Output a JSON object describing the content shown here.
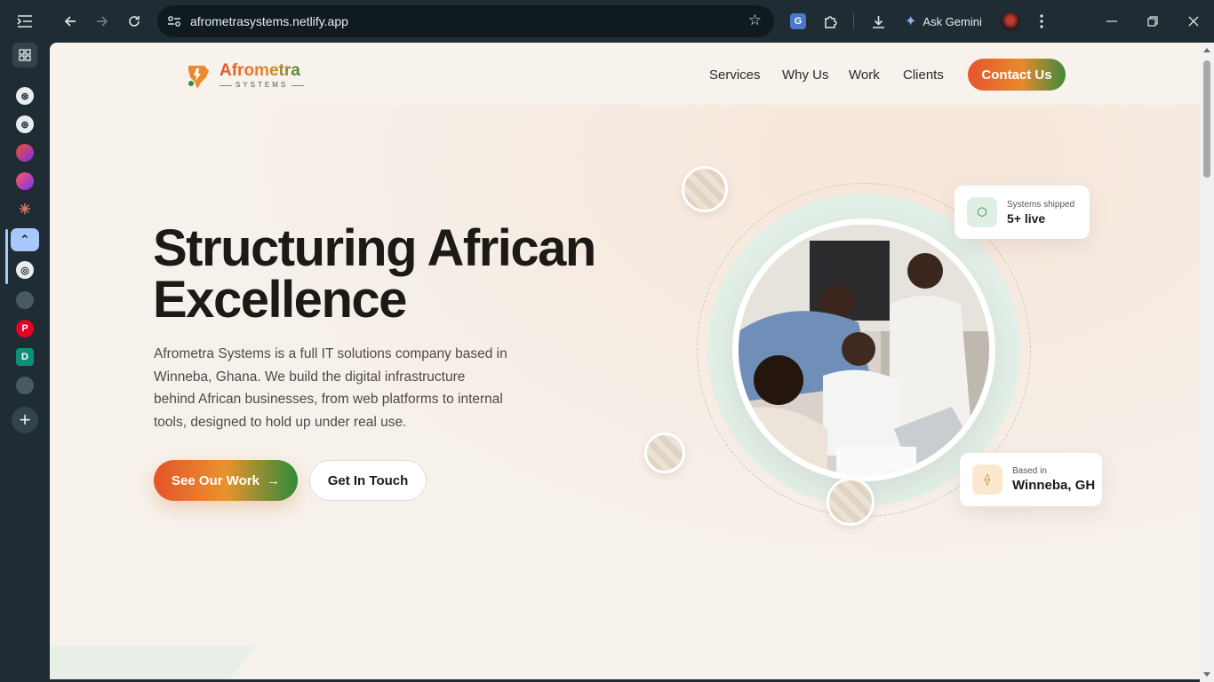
{
  "browser": {
    "url": "afrometrasystems.netlify.app",
    "gemini_label": "Ask Gemini"
  },
  "icons": {
    "sidebar_toggle": "sidebar-toggle-icon",
    "back": "back-arrow-icon",
    "forward": "forward-arrow-icon",
    "reload": "reload-icon",
    "site_info": "site-settings-icon",
    "bookmark": "star-icon",
    "translate": "translate-icon",
    "extensions": "puzzle-icon",
    "download": "download-icon",
    "gemini": "gemini-spark-icon",
    "menu": "kebab-menu-icon"
  },
  "site": {
    "brand": {
      "name": "Afrometra",
      "tagline": "SYSTEMS"
    },
    "nav": [
      "Services",
      "Why Us",
      "Work",
      "Clients"
    ],
    "contact_label": "Contact Us",
    "hero": {
      "title_line1": "Structuring African",
      "title_line2": "Excellence",
      "description": "Afrometra Systems is a full IT solutions company based in Winneba, Ghana. We build the digital infrastructure behind African businesses, from web platforms to internal tools, designed to hold up under real use.",
      "primary_cta": "See Our Work",
      "primary_cta_arrow": "→",
      "secondary_cta": "Get In Touch"
    },
    "stats": [
      {
        "label": "Systems shipped",
        "value": "5+ live",
        "icon": "hexagon-icon"
      },
      {
        "label": "Based in",
        "value": "Winneba, GH",
        "icon": "location-pin-icon"
      }
    ]
  },
  "colors": {
    "brand_orange": "#e4532b",
    "brand_amber": "#e9922c",
    "brand_green": "#2f8a3b",
    "page_bg": "#f6f1ea",
    "chrome_bg": "#1f2c33"
  }
}
